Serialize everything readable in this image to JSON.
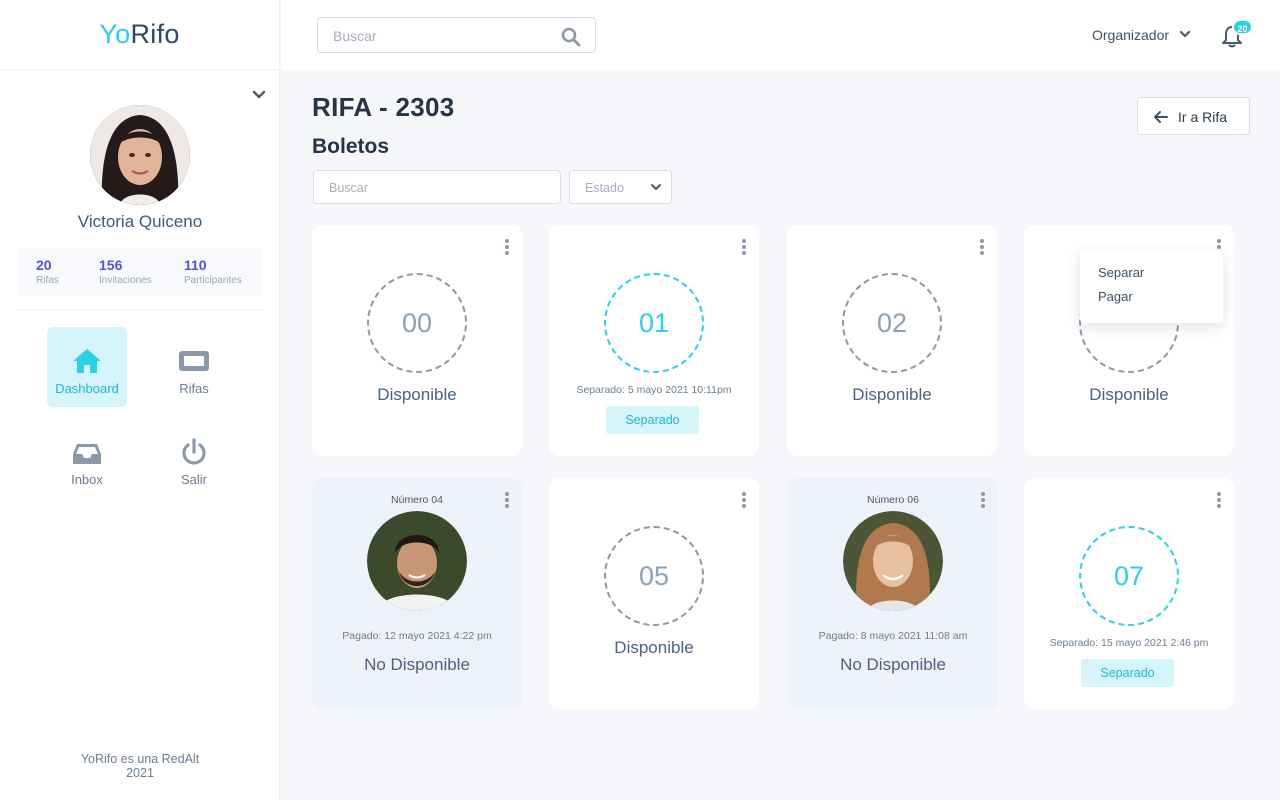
{
  "app": {
    "logo_a": "Yo",
    "logo_b": "Rifo",
    "footer_line1": "YoRifo es una RedAlt",
    "footer_line2": "2021"
  },
  "colors": {
    "accent": "#29d0e6",
    "purple": "#5b4fd8",
    "text_dark": "#263445"
  },
  "profile": {
    "name": "Victoria Quiceno",
    "stats": [
      {
        "value": "20",
        "label": "Rifas"
      },
      {
        "value": "156",
        "label": "Invitaciones"
      },
      {
        "value": "110",
        "label": "Participantes"
      }
    ]
  },
  "nav": [
    {
      "label": "Dashboard",
      "icon": "home-icon",
      "active": true
    },
    {
      "label": "Rifas",
      "icon": "ticket-icon",
      "active": false
    },
    {
      "label": "Inbox",
      "icon": "inbox-icon",
      "active": false
    },
    {
      "label": "Salir",
      "icon": "power-icon",
      "active": false
    }
  ],
  "topbar": {
    "search_placeholder": "Buscar",
    "role": "Organizador",
    "notification_count": "20"
  },
  "page": {
    "title": "RIFA - 2303",
    "section": "Boletos",
    "back_button": "Ir a Rifa"
  },
  "filters": {
    "search_placeholder": "Buscar",
    "status_placeholder": "Estado"
  },
  "tickets": [
    {
      "number": "00",
      "state": "Disponible"
    },
    {
      "number": "01",
      "state": "Separado",
      "detail": "Separado: 5 mayo 2021 10:11pm",
      "tag": "Separado"
    },
    {
      "number": "02",
      "state": "Disponible"
    },
    {
      "number": "03",
      "state": "Disponible"
    },
    {
      "number_label": "Número 04",
      "state": "No Disponible",
      "detail": "Pagado: 12 mayo 2021 4:22 pm"
    },
    {
      "number": "05",
      "state": "Disponible"
    },
    {
      "number_label": "Número 06",
      "state": "No Disponible",
      "detail": "Pagado: 8 mayo 2021 11:08 am"
    },
    {
      "number": "07",
      "state": "Separado",
      "detail": "Separado: 15 mayo 2021 2:46 pm",
      "tag": "Separado"
    }
  ],
  "context_menu": {
    "items": [
      "Separar",
      "Pagar"
    ]
  }
}
